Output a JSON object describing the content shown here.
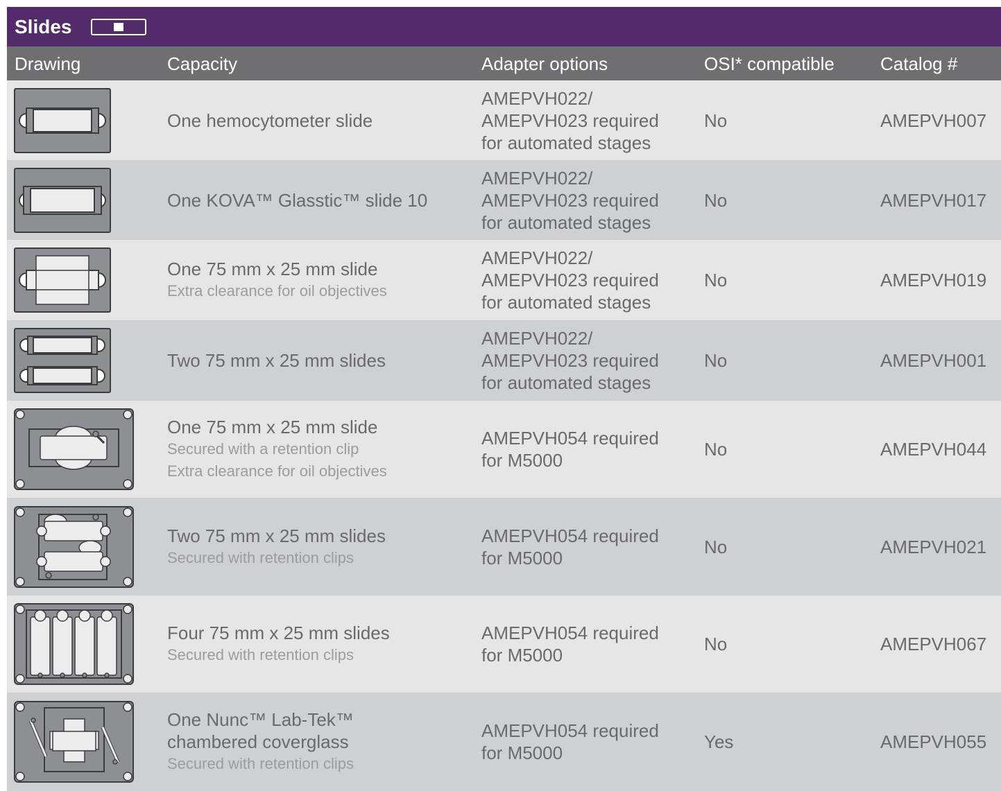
{
  "title": "Slides",
  "title_icon": "slide-holder-icon",
  "headers": [
    "Drawing",
    "Capacity",
    "Adapter options",
    "OSI* compatible",
    "Catalog #"
  ],
  "colors": {
    "title_bg": "#532b6b",
    "header_bg": "#6f6e70",
    "row_light": "#e6e6e7",
    "row_dark": "#cfd0d2",
    "text": "#6a6a6c"
  },
  "rows": [
    {
      "drawing": "single-slide-hemocytometer-icon",
      "capacity": "One hemocytometer slide",
      "capacity_sub": [],
      "adapter": [
        "AMEPVH022/",
        "AMEPVH023 required",
        "for automated stages"
      ],
      "osi": "No",
      "catalog": "AMEPVH007"
    },
    {
      "drawing": "single-slide-kova-icon",
      "capacity": "One KOVA™ Glasstic™ slide 10",
      "capacity_sub": [],
      "adapter": [
        "AMEPVH022/",
        "AMEPVH023 required",
        "for automated stages"
      ],
      "osi": "No",
      "catalog": "AMEPVH017"
    },
    {
      "drawing": "single-slide-oil-icon",
      "capacity": "One 75 mm x 25 mm slide",
      "capacity_sub": [
        "Extra clearance for oil objectives"
      ],
      "adapter": [
        "AMEPVH022/",
        "AMEPVH023 required",
        "for automated stages"
      ],
      "osi": "No",
      "catalog": "AMEPVH019"
    },
    {
      "drawing": "two-slides-icon",
      "capacity": "Two 75 mm x 25 mm slides",
      "capacity_sub": [],
      "adapter": [
        "AMEPVH022/",
        "AMEPVH023 required",
        "for automated stages"
      ],
      "osi": "No",
      "catalog": "AMEPVH001"
    },
    {
      "drawing": "single-slide-clip-icon",
      "capacity": "One 75 mm x 25 mm slide",
      "capacity_sub": [
        "Secured with a retention clip",
        "Extra clearance for oil objectives"
      ],
      "adapter": [
        "AMEPVH054 required",
        "for M5000"
      ],
      "osi": "No",
      "catalog": "AMEPVH044"
    },
    {
      "drawing": "two-slides-clips-icon",
      "capacity": "Two 75 mm x 25 mm slides",
      "capacity_sub": [
        "Secured with retention clips"
      ],
      "adapter": [
        "AMEPVH054 required",
        "for M5000"
      ],
      "osi": "No",
      "catalog": "AMEPVH021"
    },
    {
      "drawing": "four-slides-clips-icon",
      "capacity": "Four 75 mm x 25 mm slides",
      "capacity_sub": [
        "Secured with retention clips"
      ],
      "adapter": [
        "AMEPVH054 required",
        "for M5000"
      ],
      "osi": "No",
      "catalog": "AMEPVH067"
    },
    {
      "drawing": "chambered-coverglass-icon",
      "capacity": "One Nunc™ Lab-Tek™",
      "capacity_line2": "chambered coverglass",
      "capacity_sub": [
        "Secured with retention clips"
      ],
      "adapter": [
        "AMEPVH054 required",
        "for M5000"
      ],
      "osi": "Yes",
      "catalog": "AMEPVH055"
    }
  ]
}
